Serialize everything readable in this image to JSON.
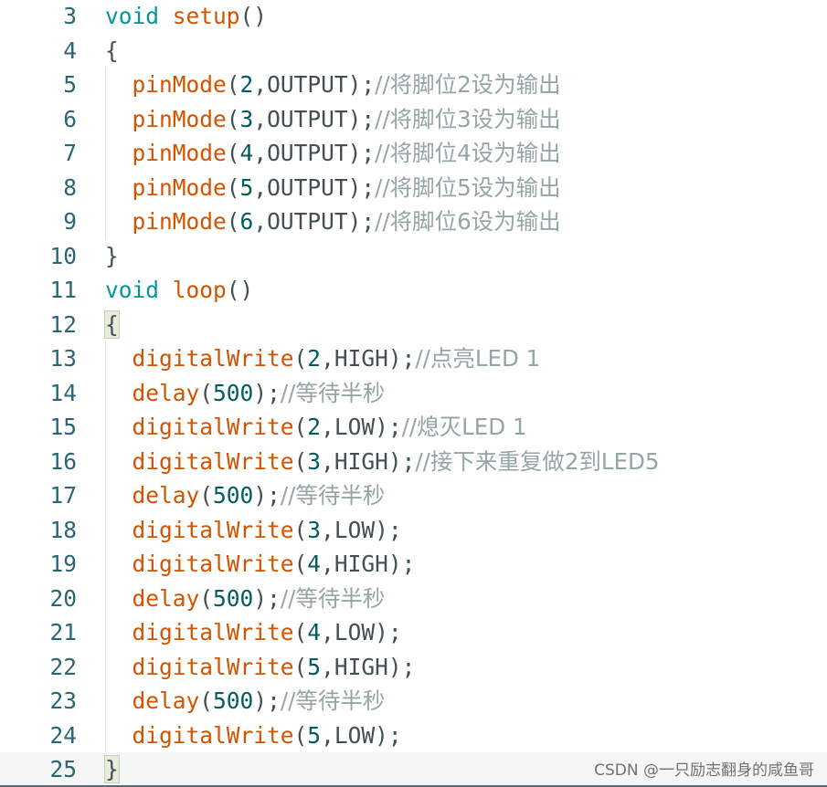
{
  "lines": [
    {
      "n": "3",
      "tokens": [
        [
          "kw",
          "void"
        ],
        [
          "p",
          " "
        ],
        [
          "fn",
          "setup"
        ],
        [
          "p",
          "()"
        ]
      ]
    },
    {
      "n": "4",
      "tokens": [
        [
          "p",
          "{"
        ]
      ]
    },
    {
      "n": "5",
      "indent": true,
      "tokens": [
        [
          "p",
          "  "
        ],
        [
          "fn",
          "pinMode"
        ],
        [
          "p",
          "("
        ],
        [
          "num",
          "2"
        ],
        [
          "p",
          ",OUTPUT);"
        ],
        [
          "cm",
          "//将脚位2设为输出"
        ]
      ]
    },
    {
      "n": "6",
      "indent": true,
      "tokens": [
        [
          "p",
          "  "
        ],
        [
          "fn",
          "pinMode"
        ],
        [
          "p",
          "("
        ],
        [
          "num",
          "3"
        ],
        [
          "p",
          ",OUTPUT);"
        ],
        [
          "cm",
          "//将脚位3设为输出"
        ]
      ]
    },
    {
      "n": "7",
      "indent": true,
      "tokens": [
        [
          "p",
          "  "
        ],
        [
          "fn",
          "pinMode"
        ],
        [
          "p",
          "("
        ],
        [
          "num",
          "4"
        ],
        [
          "p",
          ",OUTPUT);"
        ],
        [
          "cm",
          "//将脚位4设为输出"
        ]
      ]
    },
    {
      "n": "8",
      "indent": true,
      "tokens": [
        [
          "p",
          "  "
        ],
        [
          "fn",
          "pinMode"
        ],
        [
          "p",
          "("
        ],
        [
          "num",
          "5"
        ],
        [
          "p",
          ",OUTPUT);"
        ],
        [
          "cm",
          "//将脚位5设为输出"
        ]
      ]
    },
    {
      "n": "9",
      "indent": true,
      "tokens": [
        [
          "p",
          "  "
        ],
        [
          "fn",
          "pinMode"
        ],
        [
          "p",
          "("
        ],
        [
          "num",
          "6"
        ],
        [
          "p",
          ",OUTPUT);"
        ],
        [
          "cm",
          "//将脚位6设为输出"
        ]
      ]
    },
    {
      "n": "10",
      "tokens": [
        [
          "p",
          "}"
        ]
      ]
    },
    {
      "n": "11",
      "tokens": [
        [
          "kw",
          "void"
        ],
        [
          "p",
          " "
        ],
        [
          "fn",
          "loop"
        ],
        [
          "p",
          "()"
        ]
      ]
    },
    {
      "n": "12",
      "brace": true,
      "tokens": [
        [
          "p",
          "{"
        ]
      ]
    },
    {
      "n": "13",
      "indent": true,
      "tokens": [
        [
          "p",
          "  "
        ],
        [
          "fn",
          "digitalWrite"
        ],
        [
          "p",
          "("
        ],
        [
          "num",
          "2"
        ],
        [
          "p",
          ",HIGH);"
        ],
        [
          "cm",
          "//点亮LED 1"
        ]
      ]
    },
    {
      "n": "14",
      "indent": true,
      "tokens": [
        [
          "p",
          "  "
        ],
        [
          "fn",
          "delay"
        ],
        [
          "p",
          "("
        ],
        [
          "num",
          "500"
        ],
        [
          "p",
          ");"
        ],
        [
          "cm",
          "//等待半秒"
        ]
      ]
    },
    {
      "n": "15",
      "indent": true,
      "tokens": [
        [
          "p",
          "  "
        ],
        [
          "fn",
          "digitalWrite"
        ],
        [
          "p",
          "("
        ],
        [
          "num",
          "2"
        ],
        [
          "p",
          ",LOW);"
        ],
        [
          "cm",
          "//熄灭LED 1"
        ]
      ]
    },
    {
      "n": "16",
      "indent": true,
      "tokens": [
        [
          "p",
          "  "
        ],
        [
          "fn",
          "digitalWrite"
        ],
        [
          "p",
          "("
        ],
        [
          "num",
          "3"
        ],
        [
          "p",
          ",HIGH);"
        ],
        [
          "cm",
          "//接下来重复做2到LED5"
        ]
      ]
    },
    {
      "n": "17",
      "indent": true,
      "tokens": [
        [
          "p",
          "  "
        ],
        [
          "fn",
          "delay"
        ],
        [
          "p",
          "("
        ],
        [
          "num",
          "500"
        ],
        [
          "p",
          ");"
        ],
        [
          "cm",
          "//等待半秒"
        ]
      ]
    },
    {
      "n": "18",
      "indent": true,
      "tokens": [
        [
          "p",
          "  "
        ],
        [
          "fn",
          "digitalWrite"
        ],
        [
          "p",
          "("
        ],
        [
          "num",
          "3"
        ],
        [
          "p",
          ",LOW);"
        ]
      ]
    },
    {
      "n": "19",
      "indent": true,
      "tokens": [
        [
          "p",
          "  "
        ],
        [
          "fn",
          "digitalWrite"
        ],
        [
          "p",
          "("
        ],
        [
          "num",
          "4"
        ],
        [
          "p",
          ",HIGH);"
        ]
      ]
    },
    {
      "n": "20",
      "indent": true,
      "tokens": [
        [
          "p",
          "  "
        ],
        [
          "fn",
          "delay"
        ],
        [
          "p",
          "("
        ],
        [
          "num",
          "500"
        ],
        [
          "p",
          ");"
        ],
        [
          "cm",
          "//等待半秒"
        ]
      ]
    },
    {
      "n": "21",
      "indent": true,
      "tokens": [
        [
          "p",
          "  "
        ],
        [
          "fn",
          "digitalWrite"
        ],
        [
          "p",
          "("
        ],
        [
          "num",
          "4"
        ],
        [
          "p",
          ",LOW);"
        ]
      ]
    },
    {
      "n": "22",
      "indent": true,
      "tokens": [
        [
          "p",
          "  "
        ],
        [
          "fn",
          "digitalWrite"
        ],
        [
          "p",
          "("
        ],
        [
          "num",
          "5"
        ],
        [
          "p",
          ",HIGH);"
        ]
      ]
    },
    {
      "n": "23",
      "indent": true,
      "tokens": [
        [
          "p",
          "  "
        ],
        [
          "fn",
          "delay"
        ],
        [
          "p",
          "("
        ],
        [
          "num",
          "500"
        ],
        [
          "p",
          ");"
        ],
        [
          "cm",
          "//等待半秒"
        ]
      ]
    },
    {
      "n": "24",
      "indent": true,
      "tokens": [
        [
          "p",
          "  "
        ],
        [
          "fn",
          "digitalWrite"
        ],
        [
          "p",
          "("
        ],
        [
          "num",
          "5"
        ],
        [
          "p",
          ",LOW);"
        ]
      ]
    },
    {
      "n": "25",
      "active": true,
      "brace": true,
      "tokens": [
        [
          "p",
          "}"
        ]
      ]
    }
  ],
  "watermark": "CSDN @一只励志翻身的咸鱼哥",
  "colors": {
    "keyword": "#00979d",
    "function": "#d35400",
    "number": "#005c5f",
    "comment": "#95a5a6",
    "line_number": "#2b6674",
    "text": "#434f54"
  }
}
